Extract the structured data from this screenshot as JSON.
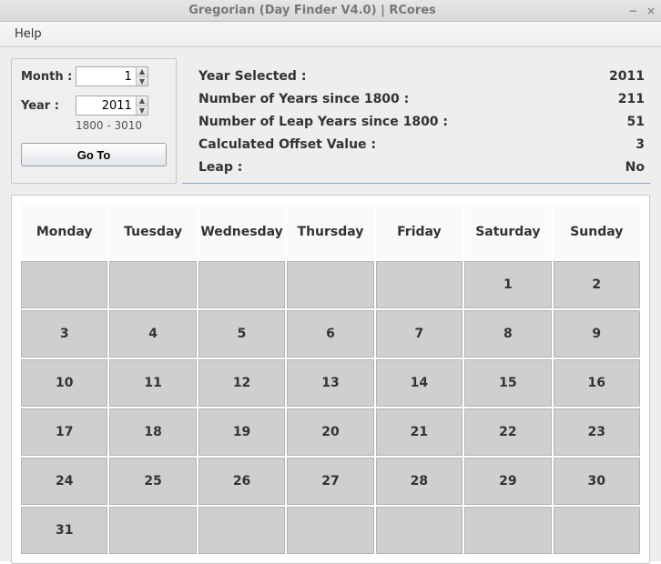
{
  "window": {
    "title": "Gregorian (Day Finder V4.0) | RCores"
  },
  "menu": {
    "help": "Help"
  },
  "form": {
    "month_label": "Month :",
    "month_value": "1",
    "year_label": "Year :",
    "year_value": "2011",
    "year_hint": "1800 - 3010",
    "go_label": "Go To"
  },
  "info": {
    "year_selected_label": "Year Selected :",
    "year_selected_value": "2011",
    "years_since_label": "Number of Years since 1800 :",
    "years_since_value": "211",
    "leap_since_label": "Number of Leap Years since 1800 :",
    "leap_since_value": "51",
    "offset_label": "Calculated Offset Value :",
    "offset_value": "3",
    "leap_label": "Leap :",
    "leap_value": "No"
  },
  "calendar": {
    "days": [
      "Monday",
      "Tuesday",
      "Wednesday",
      "Thursday",
      "Friday",
      "Saturday",
      "Sunday"
    ],
    "grid": [
      [
        "",
        "",
        "",
        "",
        "",
        "1",
        "2"
      ],
      [
        "3",
        "4",
        "5",
        "6",
        "7",
        "8",
        "9"
      ],
      [
        "10",
        "11",
        "12",
        "13",
        "14",
        "15",
        "16"
      ],
      [
        "17",
        "18",
        "19",
        "20",
        "21",
        "22",
        "23"
      ],
      [
        "24",
        "25",
        "26",
        "27",
        "28",
        "29",
        "30"
      ],
      [
        "31",
        "",
        "",
        "",
        "",
        "",
        ""
      ]
    ]
  }
}
